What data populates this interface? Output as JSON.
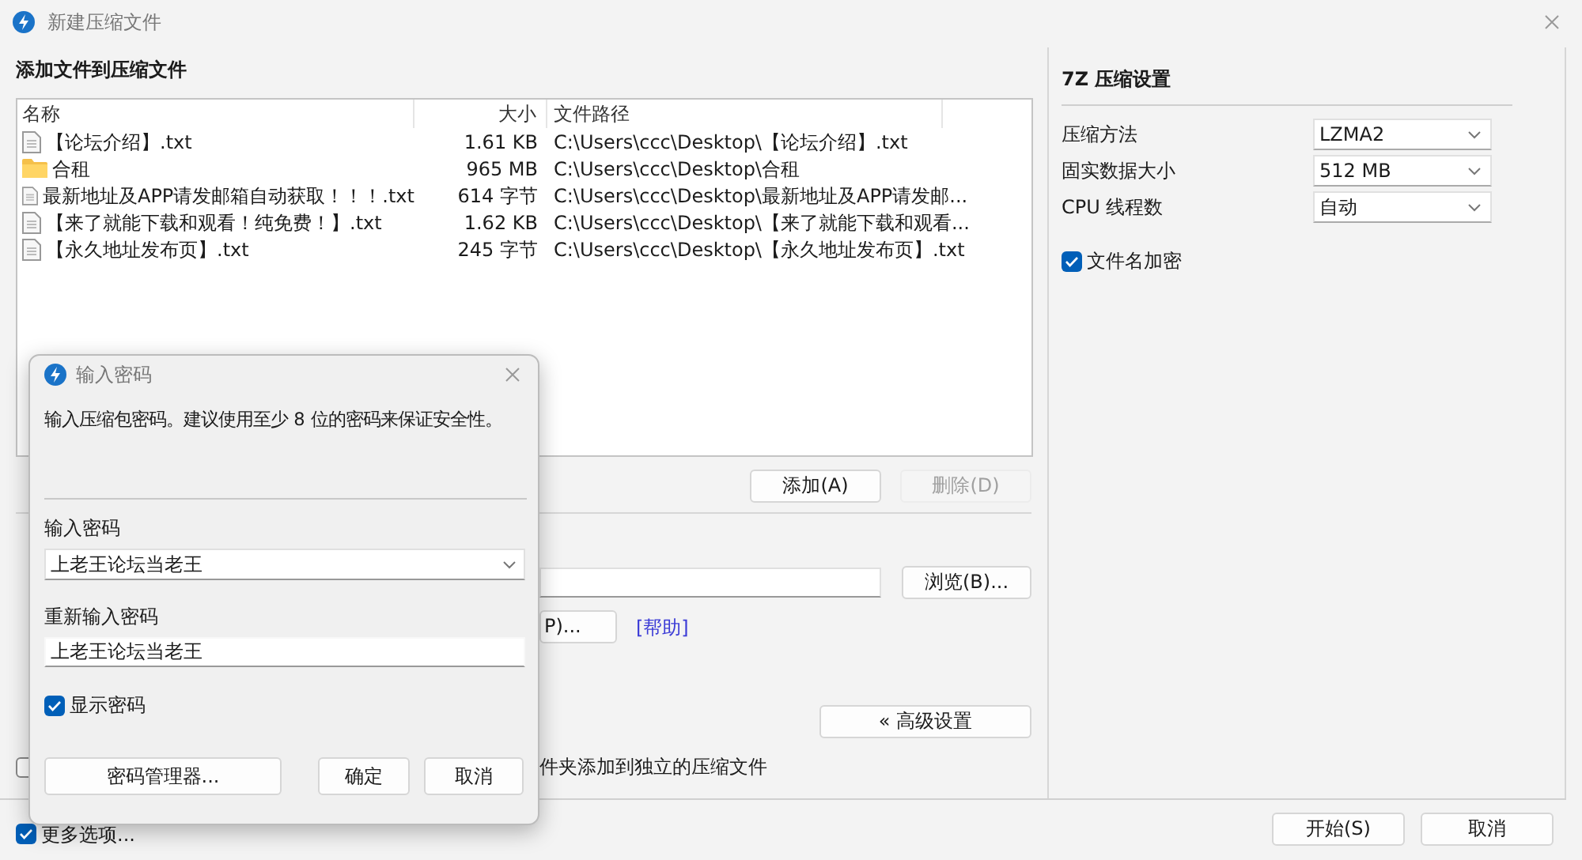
{
  "window": {
    "title": "新建压缩文件"
  },
  "files": {
    "heading": "添加文件到压缩文件",
    "columns": [
      "名称",
      "大小",
      "文件路径"
    ],
    "rows": [
      {
        "kind": "file",
        "name": "【论坛介绍】.txt",
        "size": "1.61 KB",
        "path": "C:\\Users\\ccc\\Desktop\\【论坛介绍】.txt"
      },
      {
        "kind": "folder",
        "name": "合租",
        "size": "965 MB",
        "path": "C:\\Users\\ccc\\Desktop\\合租"
      },
      {
        "kind": "file",
        "name": "最新地址及APP请发邮箱自动获取！！！.txt",
        "size": "614 字节",
        "path": "C:\\Users\\ccc\\Desktop\\最新地址及APP请发邮..."
      },
      {
        "kind": "file",
        "name": "【来了就能下载和观看！纯免费！】.txt",
        "size": "1.62 KB",
        "path": "C:\\Users\\ccc\\Desktop\\【来了就能下载和观看..."
      },
      {
        "kind": "file",
        "name": "【永久地址发布页】.txt",
        "size": "245 字节",
        "path": "C:\\Users\\ccc\\Desktop\\【永久地址发布页】.txt"
      }
    ],
    "buttons": [
      {
        "label": "添加(A)",
        "disabled": false
      },
      {
        "label": "删除(D)",
        "disabled": true
      }
    ]
  },
  "archive_options": {
    "rows": [
      {
        "kind": "path",
        "button": "浏览(B)..."
      },
      {
        "kind": "button",
        "button": "P)...",
        "link": "[帮助]"
      },
      {
        "kind": "advanced",
        "button": "« 高级设置"
      }
    ],
    "separate_archives": {
      "label": "件夹添加到独立的压缩文件",
      "checked": false
    }
  },
  "settings_7z": {
    "title": "7Z 压缩设置",
    "fields": [
      {
        "label": "压缩方法",
        "value": "LZMA2"
      },
      {
        "label": "固实数据大小",
        "value": "512 MB"
      },
      {
        "label": "CPU 线程数",
        "value": "自动"
      }
    ],
    "encrypt_names": {
      "label": "文件名加密",
      "checked": true
    }
  },
  "more_options": {
    "label": "更多选项...",
    "checked": true
  },
  "footer_buttons": [
    "开始(S)",
    "取消"
  ],
  "password_dialog": {
    "title": "输入密码",
    "message": "输入压缩包密码。建议使用至少 8 位的密码来保证安全性。",
    "password_label": "输入密码",
    "password": "上老王论坛当老王",
    "confirm_label": "重新输入密码",
    "confirm": "上老王论坛当老王",
    "show_password": {
      "label": "显示密码",
      "checked": true
    },
    "buttons": [
      "密码管理器...",
      "确定",
      "取消"
    ]
  }
}
